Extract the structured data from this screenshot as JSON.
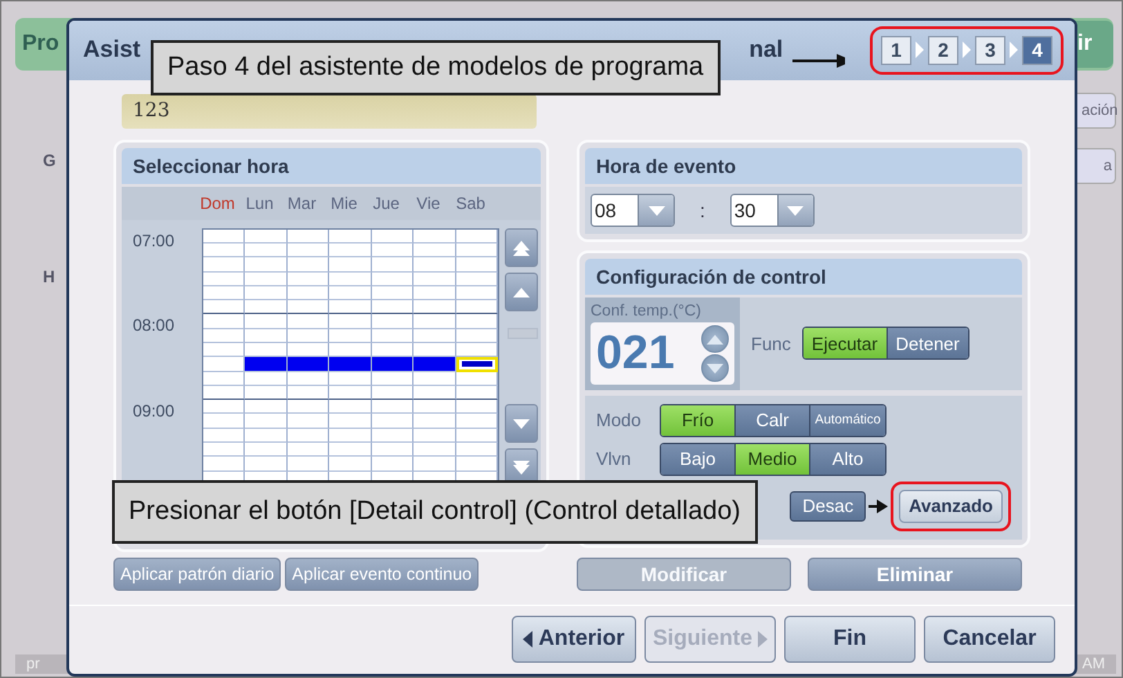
{
  "background": {
    "title": "Pro",
    "button": "ir",
    "tab": "ación",
    "side_tab": "a",
    "side_labels": [
      "G",
      "H"
    ],
    "status_left": "pr",
    "status_right": "AM"
  },
  "window": {
    "title_start": "Asist",
    "title_end": "nal"
  },
  "steps": [
    {
      "label": "1",
      "selected": false
    },
    {
      "label": "2",
      "selected": false
    },
    {
      "label": "3",
      "selected": false
    },
    {
      "label": "4",
      "selected": true
    }
  ],
  "name_field": {
    "value": "123"
  },
  "time_select": {
    "title": "Seleccionar hora",
    "time_labels": [
      "07:00",
      "08:00",
      "09:00"
    ],
    "days": [
      {
        "label": "Dom",
        "holiday": true,
        "scheduled": false,
        "focused": false
      },
      {
        "label": "Lun",
        "holiday": false,
        "scheduled": true,
        "focused": false
      },
      {
        "label": "Mar",
        "holiday": false,
        "scheduled": true,
        "focused": false
      },
      {
        "label": "Mie",
        "holiday": false,
        "scheduled": true,
        "focused": false
      },
      {
        "label": "Jue",
        "holiday": false,
        "scheduled": true,
        "focused": false
      },
      {
        "label": "Vie",
        "holiday": false,
        "scheduled": true,
        "focused": false
      },
      {
        "label": "Sab",
        "holiday": false,
        "scheduled": true,
        "focused": true
      }
    ]
  },
  "event_time": {
    "title": "Hora de evento",
    "hour": "08",
    "separator": ":",
    "minute": "30"
  },
  "control": {
    "title": "Configuración de control",
    "temp_label": "Conf. temp.(°C)",
    "temp_value": "021",
    "func": {
      "label": "Func",
      "options": [
        {
          "label": "Ejecutar",
          "selected": true
        },
        {
          "label": "Detener",
          "selected": false
        }
      ]
    },
    "modes": [
      {
        "label": "Modo",
        "options": [
          {
            "label": "Frío",
            "selected": true
          },
          {
            "label": "Calr",
            "selected": false
          },
          {
            "label": "Automático",
            "selected": false
          }
        ]
      },
      {
        "label": "Vlvn",
        "options": [
          {
            "label": "Bajo",
            "selected": false
          },
          {
            "label": "Medio",
            "selected": true
          },
          {
            "label": "Alto",
            "selected": false
          }
        ]
      }
    ],
    "extra_option": "Desac",
    "advanced_button": "Avanzado"
  },
  "schedule_buttons": [
    "Aplicar patrón diario",
    "Aplicar evento continuo"
  ],
  "edit_buttons": [
    {
      "label": "Modificar",
      "disabled": true
    },
    {
      "label": "Eliminar",
      "disabled": false
    }
  ],
  "nav_buttons": [
    {
      "kind": "back",
      "label": "Anterior",
      "disabled": false
    },
    {
      "kind": "next",
      "label": "Siguiente",
      "disabled": true
    },
    {
      "kind": "plain",
      "label": "Fin",
      "disabled": false
    },
    {
      "kind": "plain",
      "label": "Cancelar",
      "disabled": false
    }
  ],
  "callouts": [
    {
      "text": "Paso 4 del asistente de modelos de programa"
    },
    {
      "text": "Presionar el botón [Detail control] (Control detallado)"
    }
  ]
}
